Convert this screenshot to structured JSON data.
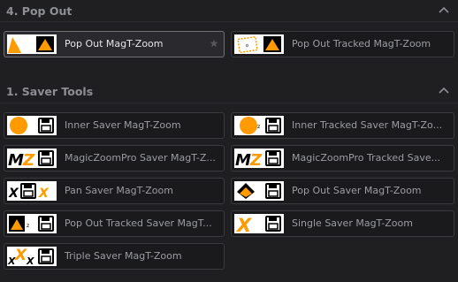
{
  "sections": [
    {
      "title": "4. Pop Out"
    },
    {
      "title": "1. Saver Tools"
    }
  ],
  "popout_tools": [
    {
      "label": "Pop Out MagT-Zoom",
      "selected": true,
      "favorite_icon": "star-icon"
    },
    {
      "label": "Pop Out Tracked MagT-Zoom",
      "selected": false
    }
  ],
  "saver_tools": [
    {
      "label": "Inner Saver MagT-Zoom"
    },
    {
      "label": "Inner Tracked Saver MagT-Zo..."
    },
    {
      "label": "MagicZoomPro Saver MagT-Z..."
    },
    {
      "label": "MagicZoomPro Tracked Save..."
    },
    {
      "label": "Pan Saver MagT-Zoom"
    },
    {
      "label": "Pop Out Saver MagT-Zoom"
    },
    {
      "label": "Pop Out Tracked Saver MagT..."
    },
    {
      "label": "Single Saver MagT-Zoom"
    },
    {
      "label": "Triple Saver MagT-Zoom"
    }
  ],
  "colors": {
    "accent_orange": "#ff9a00",
    "panel_bg": "#1f1f22",
    "tile_bg": "#1a1a1d",
    "selected_border": "#6e7076"
  }
}
